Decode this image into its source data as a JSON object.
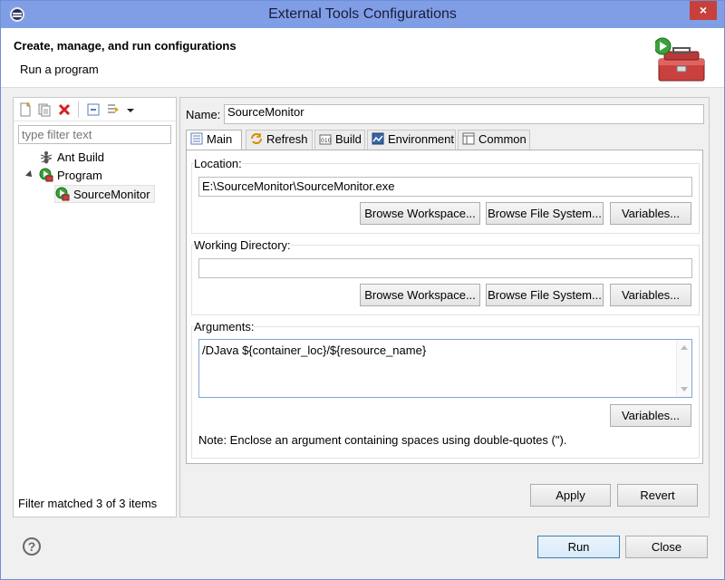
{
  "window": {
    "title": "External Tools Configurations",
    "close_glyph": "×"
  },
  "header": {
    "title": "Create, manage, and run configurations",
    "subtitle": "Run a program",
    "icon": "toolbox-run-icon"
  },
  "left": {
    "toolbar_icons": [
      "new-configuration-icon",
      "duplicate-icon",
      "delete-icon",
      "collapse-all-icon",
      "filter-icon",
      "dropdown-icon"
    ],
    "filter_placeholder": "type filter text",
    "tree": [
      {
        "label": "Ant Build",
        "icon": "ant-icon"
      },
      {
        "label": "Program",
        "icon": "program-icon",
        "expanded": true
      },
      {
        "label": "SourceMonitor",
        "icon": "program-config-icon",
        "selected": true
      }
    ],
    "footer": "Filter matched 3 of 3 items"
  },
  "right": {
    "name_label": "Name:",
    "name_value": "SourceMonitor",
    "tabs": [
      {
        "label": "Main",
        "icon": "main-tab-icon",
        "active": true
      },
      {
        "label": "Refresh",
        "icon": "refresh-icon"
      },
      {
        "label": "Build",
        "icon": "build-icon"
      },
      {
        "label": "Environment",
        "icon": "environment-icon"
      },
      {
        "label": "Common",
        "icon": "common-icon"
      }
    ],
    "location": {
      "label": "Location:",
      "value": "E:\\SourceMonitor\\SourceMonitor.exe",
      "buttons": [
        "Browse Workspace...",
        "Browse File System...",
        "Variables..."
      ]
    },
    "working_directory": {
      "label": "Working Directory:",
      "value": "",
      "buttons": [
        "Browse Workspace...",
        "Browse File System...",
        "Variables..."
      ]
    },
    "arguments": {
      "label": "Arguments:",
      "value": "/DJava ${container_loc}/${resource_name}",
      "button": "Variables...",
      "note": "Note: Enclose an argument containing spaces using double-quotes (\")."
    },
    "apply_label": "Apply",
    "revert_label": "Revert"
  },
  "footer": {
    "help_glyph": "?",
    "run_label": "Run",
    "close_label": "Close"
  }
}
